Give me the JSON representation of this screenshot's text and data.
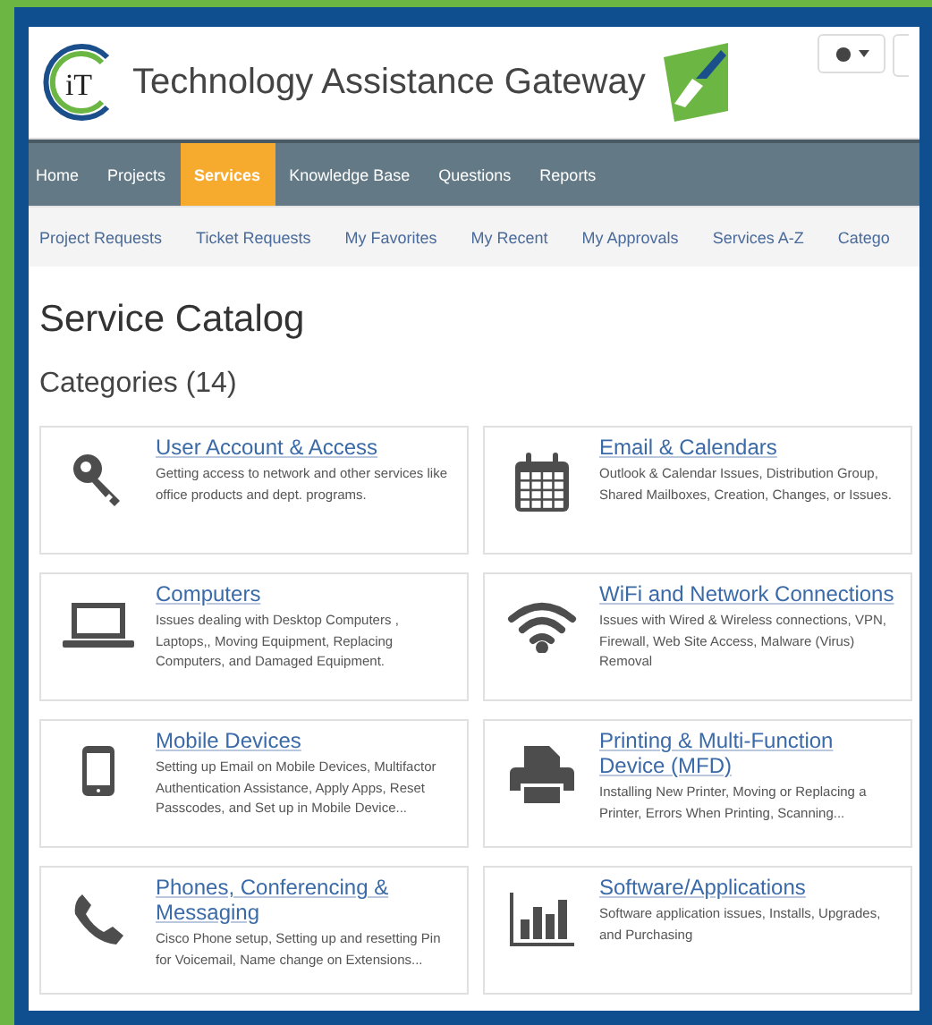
{
  "header": {
    "logo_text": "iT",
    "title": "Technology Assistance Gateway"
  },
  "nav": [
    {
      "label": "Home",
      "selected": false
    },
    {
      "label": "Projects",
      "selected": false
    },
    {
      "label": "Services",
      "selected": true
    },
    {
      "label": "Knowledge Base",
      "selected": false
    },
    {
      "label": "Questions",
      "selected": false
    },
    {
      "label": "Reports",
      "selected": false
    }
  ],
  "subnav": [
    "Project Requests",
    "Ticket Requests",
    "My Favorites",
    "My Recent",
    "My Approvals",
    "Services A-Z",
    "Catego"
  ],
  "page_title": "Service Catalog",
  "categories_heading": "Categories (14)",
  "categories": [
    {
      "kind": "key",
      "title": "User Account & Access",
      "description": "Getting access to network and other services like office products and dept. programs."
    },
    {
      "kind": "calendar",
      "title": "Email & Calendars",
      "description": "Outlook & Calendar Issues, Distribution Group, Shared Mailboxes, Creation, Changes, or Issues."
    },
    {
      "kind": "laptop",
      "title": "Computers",
      "description": "Issues dealing with Desktop Computers , Laptops,, Moving Equipment, Replacing Computers, and Damaged Equipment."
    },
    {
      "kind": "wifi",
      "title": "WiFi and Network Connections",
      "description": "Issues with Wired & Wireless connections, VPN, Firewall, Web Site Access, Malware (Virus) Removal"
    },
    {
      "kind": "phone",
      "title": "Mobile Devices",
      "description": "Setting up Email on Mobile Devices, Multifactor Authentication Assistance, Apply Apps, Reset Passcodes, and Set up in Mobile Device..."
    },
    {
      "kind": "printer",
      "title": "Printing & Multi-Function Device (MFD)",
      "description": "Installing New Printer, Moving or Replacing a Printer, Errors When Printing, Scanning..."
    },
    {
      "kind": "handset",
      "title": "Phones, Conferencing & Messaging",
      "description": "Cisco Phone setup, Setting up and resetting Pin for Voicemail, Name change on Extensions..."
    },
    {
      "kind": "chart",
      "title": "Software/Applications",
      "description": "Software application issues, Installs, Upgrades, and Purchasing"
    }
  ]
}
